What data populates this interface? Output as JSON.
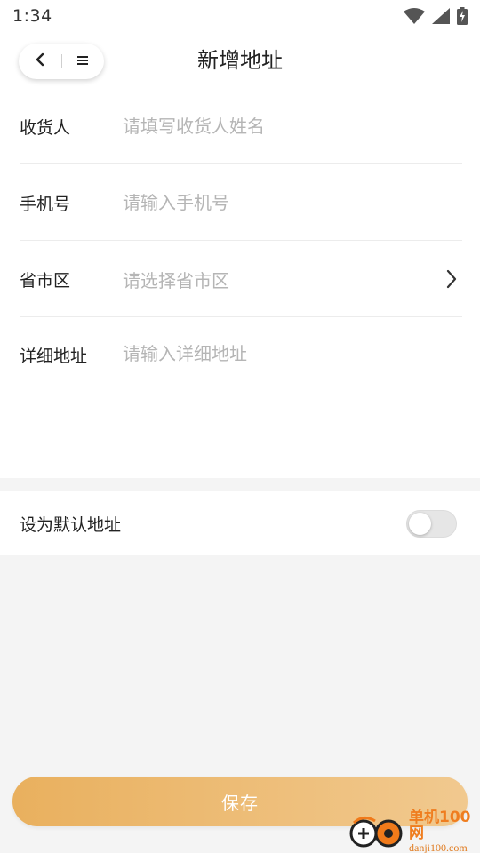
{
  "status_bar": {
    "time": "1:34",
    "icons": [
      "wifi-icon",
      "cellular-signal-icon",
      "battery-charging-icon"
    ]
  },
  "header": {
    "title": "新增地址",
    "back_icon": "chevron-left-icon",
    "menu_icon": "hamburger-menu-icon"
  },
  "form": {
    "consignee": {
      "label": "收货人",
      "placeholder": "请填写收货人姓名",
      "value": ""
    },
    "phone": {
      "label": "手机号",
      "placeholder": "请输入手机号",
      "value": ""
    },
    "region": {
      "label": "省市区",
      "placeholder": "请选择省市区",
      "icon": "chevron-right-icon"
    },
    "detail": {
      "label": "详细地址",
      "placeholder": "请输入详细地址",
      "value": ""
    }
  },
  "default_switch": {
    "label": "设为默认地址",
    "on": false
  },
  "save_button": {
    "label": "保存"
  },
  "watermark": {
    "brand": "单机100网",
    "url": "danji100.com"
  },
  "colors": {
    "accent_start": "#e9b05e",
    "accent_end": "#f1c98f",
    "watermark_orange": "#ef7d1f",
    "placeholder": "#b5b5b5"
  }
}
